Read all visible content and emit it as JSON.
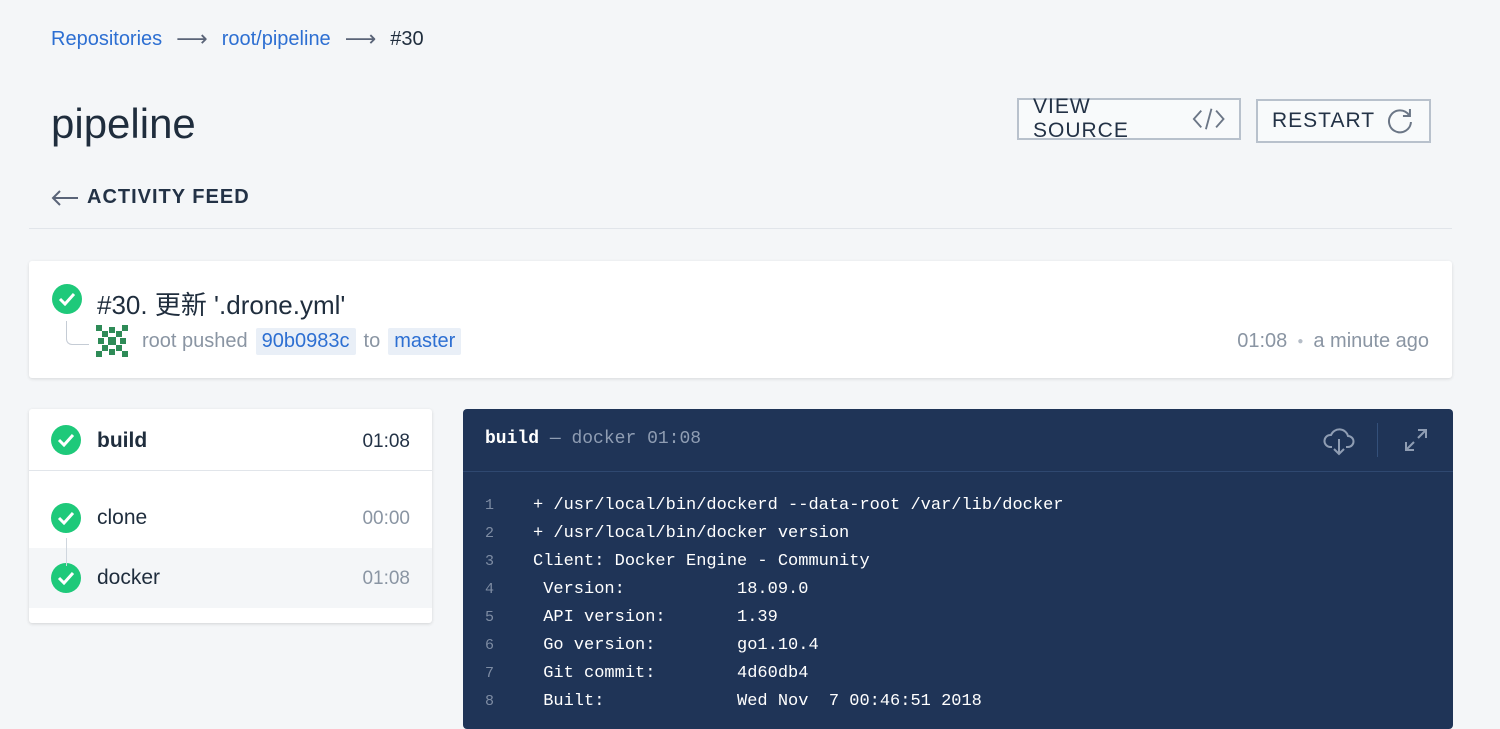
{
  "breadcrumb": {
    "repositories": "Repositories",
    "repo": "root/pipeline",
    "current": "#30",
    "separator": "⟶"
  },
  "page_title": "pipeline",
  "buttons": {
    "view_source": "VIEW SOURCE",
    "restart": "RESTART"
  },
  "activity_feed": "ACTIVITY FEED",
  "build": {
    "title": "#30. 更新 '.drone.yml'",
    "author": "root",
    "action": "pushed",
    "commit": "90b0983c",
    "to": "to",
    "branch": "master",
    "time": "01:08",
    "relative": "a minute ago",
    "status_color": "#1ec97a"
  },
  "stage": {
    "name": "build",
    "duration": "01:08",
    "steps": [
      {
        "name": "clone",
        "duration": "00:00"
      },
      {
        "name": "docker",
        "duration": "01:08"
      }
    ]
  },
  "log": {
    "step": "build",
    "separator": "—",
    "subtitle": "docker",
    "duration": "01:08",
    "lines": [
      {
        "num": "1",
        "text": "+ /usr/local/bin/dockerd --data-root /var/lib/docker"
      },
      {
        "num": "2",
        "text": "+ /usr/local/bin/docker version"
      },
      {
        "num": "3",
        "text": "Client: Docker Engine - Community"
      },
      {
        "num": "4",
        "text": " Version:           18.09.0"
      },
      {
        "num": "5",
        "text": " API version:       1.39"
      },
      {
        "num": "6",
        "text": " Go version:        go1.10.4"
      },
      {
        "num": "7",
        "text": " Git commit:        4d60db4"
      },
      {
        "num": "8",
        "text": " Built:             Wed Nov  7 00:46:51 2018"
      }
    ]
  }
}
